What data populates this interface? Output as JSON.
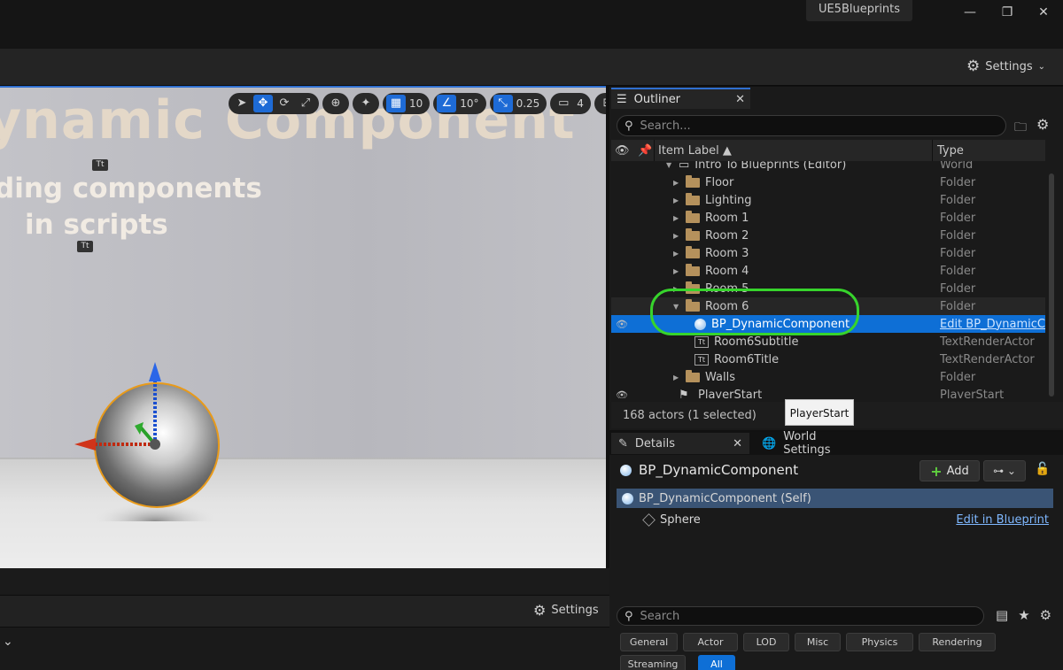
{
  "window": {
    "title": "UE5Blueprints",
    "minimize": "—",
    "maximize": "❐",
    "close": "✕"
  },
  "toolbar": {
    "settings_label": "Settings"
  },
  "viewport": {
    "title_text": "ynamic Component",
    "subtitle_line1": "ding components",
    "subtitle_line2": "in scripts",
    "grid_snap": "10",
    "rotation_snap": "10°",
    "scale_snap": "0.25",
    "camera_speed": "4",
    "bottom_settings_label": "Settings"
  },
  "outliner": {
    "tab_label": "Outliner",
    "search_placeholder": "Search...",
    "col_label": "Item Label ▲",
    "col_type": "Type",
    "rows": [
      {
        "label": "Intro To Blueprints (Editor)",
        "type": "World",
        "kind": "world",
        "indent": 0
      },
      {
        "label": "Floor",
        "type": "Folder",
        "kind": "folder",
        "indent": 1
      },
      {
        "label": "Lighting",
        "type": "Folder",
        "kind": "folder",
        "indent": 1
      },
      {
        "label": "Room 1",
        "type": "Folder",
        "kind": "folder",
        "indent": 1
      },
      {
        "label": "Room 2",
        "type": "Folder",
        "kind": "folder",
        "indent": 1
      },
      {
        "label": "Room 3",
        "type": "Folder",
        "kind": "folder",
        "indent": 1
      },
      {
        "label": "Room 4",
        "type": "Folder",
        "kind": "folder",
        "indent": 1
      },
      {
        "label": "Room 5",
        "type": "Folder",
        "kind": "folder",
        "indent": 1
      },
      {
        "label": "Room 6",
        "type": "Folder",
        "kind": "folder-open",
        "indent": 1
      },
      {
        "label": "BP_DynamicComponent",
        "type": "Edit BP_DynamicCom",
        "kind": "bp",
        "indent": 2,
        "selected": true
      },
      {
        "label": "Room6Subtitle",
        "type": "TextRenderActor",
        "kind": "text",
        "indent": 2
      },
      {
        "label": "Room6Title",
        "type": "TextRenderActor",
        "kind": "text",
        "indent": 2
      },
      {
        "label": "Walls",
        "type": "Folder",
        "kind": "folder",
        "indent": 1
      },
      {
        "label": "PlayerStart",
        "type": "PlayerStart",
        "kind": "playerstart",
        "indent": 1
      }
    ],
    "footer": "168 actors (1 selected)",
    "tooltip": "PlayerStart"
  },
  "details": {
    "tab_label": "Details",
    "world_settings_label": "World Settings",
    "actor_name": "BP_DynamicComponent",
    "add_label": "Add",
    "components": [
      {
        "label": "BP_DynamicComponent (Self)"
      },
      {
        "label": "Sphere"
      }
    ],
    "edit_in_blueprint": "Edit in Blueprint",
    "search_placeholder": "Search",
    "filters": [
      "General",
      "Actor",
      "LOD",
      "Misc",
      "Physics",
      "Rendering",
      "Streaming",
      "All"
    ]
  }
}
